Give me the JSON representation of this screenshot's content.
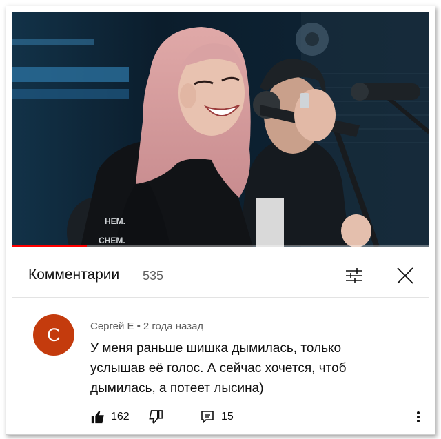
{
  "video": {
    "progress": 0.18,
    "overlay_text": [
      "HEM.",
      "CHEM."
    ]
  },
  "comments_panel": {
    "title": "Комментарии",
    "count": "535",
    "filter_icon": "sliders-icon",
    "close_icon": "close-icon"
  },
  "comment": {
    "avatar_letter": "С",
    "author": "Сергей Е",
    "time": "2 года назад",
    "text": "У меня раньше шишка дымилась, только услышав её голос. А сейчас хочется, чтоб дымилась, а потеет лысина)",
    "likes": "162",
    "replies": "15"
  },
  "colors": {
    "accent": "#ff0000",
    "avatar": "#c43b0d"
  }
}
